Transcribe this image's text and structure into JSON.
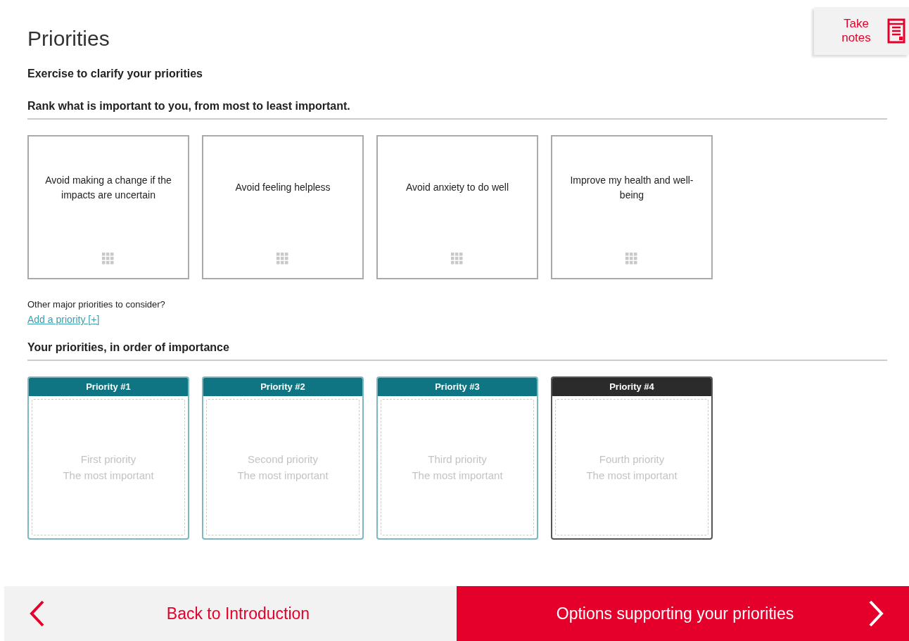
{
  "title": "Priorities",
  "take_notes": {
    "label": "Take notes"
  },
  "exercise_heading": "Exercise to clarify your priorities",
  "rank_heading": "Rank what is important to you, from most to least important.",
  "cards": [
    {
      "text": "Avoid making a change if the impacts are uncertain"
    },
    {
      "text": "Avoid feeling helpless"
    },
    {
      "text": "Avoid anxiety to do well"
    },
    {
      "text": "Improve my health and well-being"
    }
  ],
  "other_prompt": "Other major priorities to consider?",
  "add_link": "Add a priority [+]",
  "order_heading": "Your priorities, in order of importance",
  "slots": [
    {
      "header": "Priority #1",
      "placeholder_1": "First priority",
      "placeholder_2": "The most important",
      "active": false
    },
    {
      "header": "Priority #2",
      "placeholder_1": "Second priority",
      "placeholder_2": "The most important",
      "active": false
    },
    {
      "header": "Priority #3",
      "placeholder_1": "Third priority",
      "placeholder_2": "The most important",
      "active": false
    },
    {
      "header": "Priority #4",
      "placeholder_1": "Fourth priority",
      "placeholder_2": "The most important",
      "active": true
    }
  ],
  "nav": {
    "back": "Back to Introduction",
    "next": "Options supporting your priorities"
  }
}
